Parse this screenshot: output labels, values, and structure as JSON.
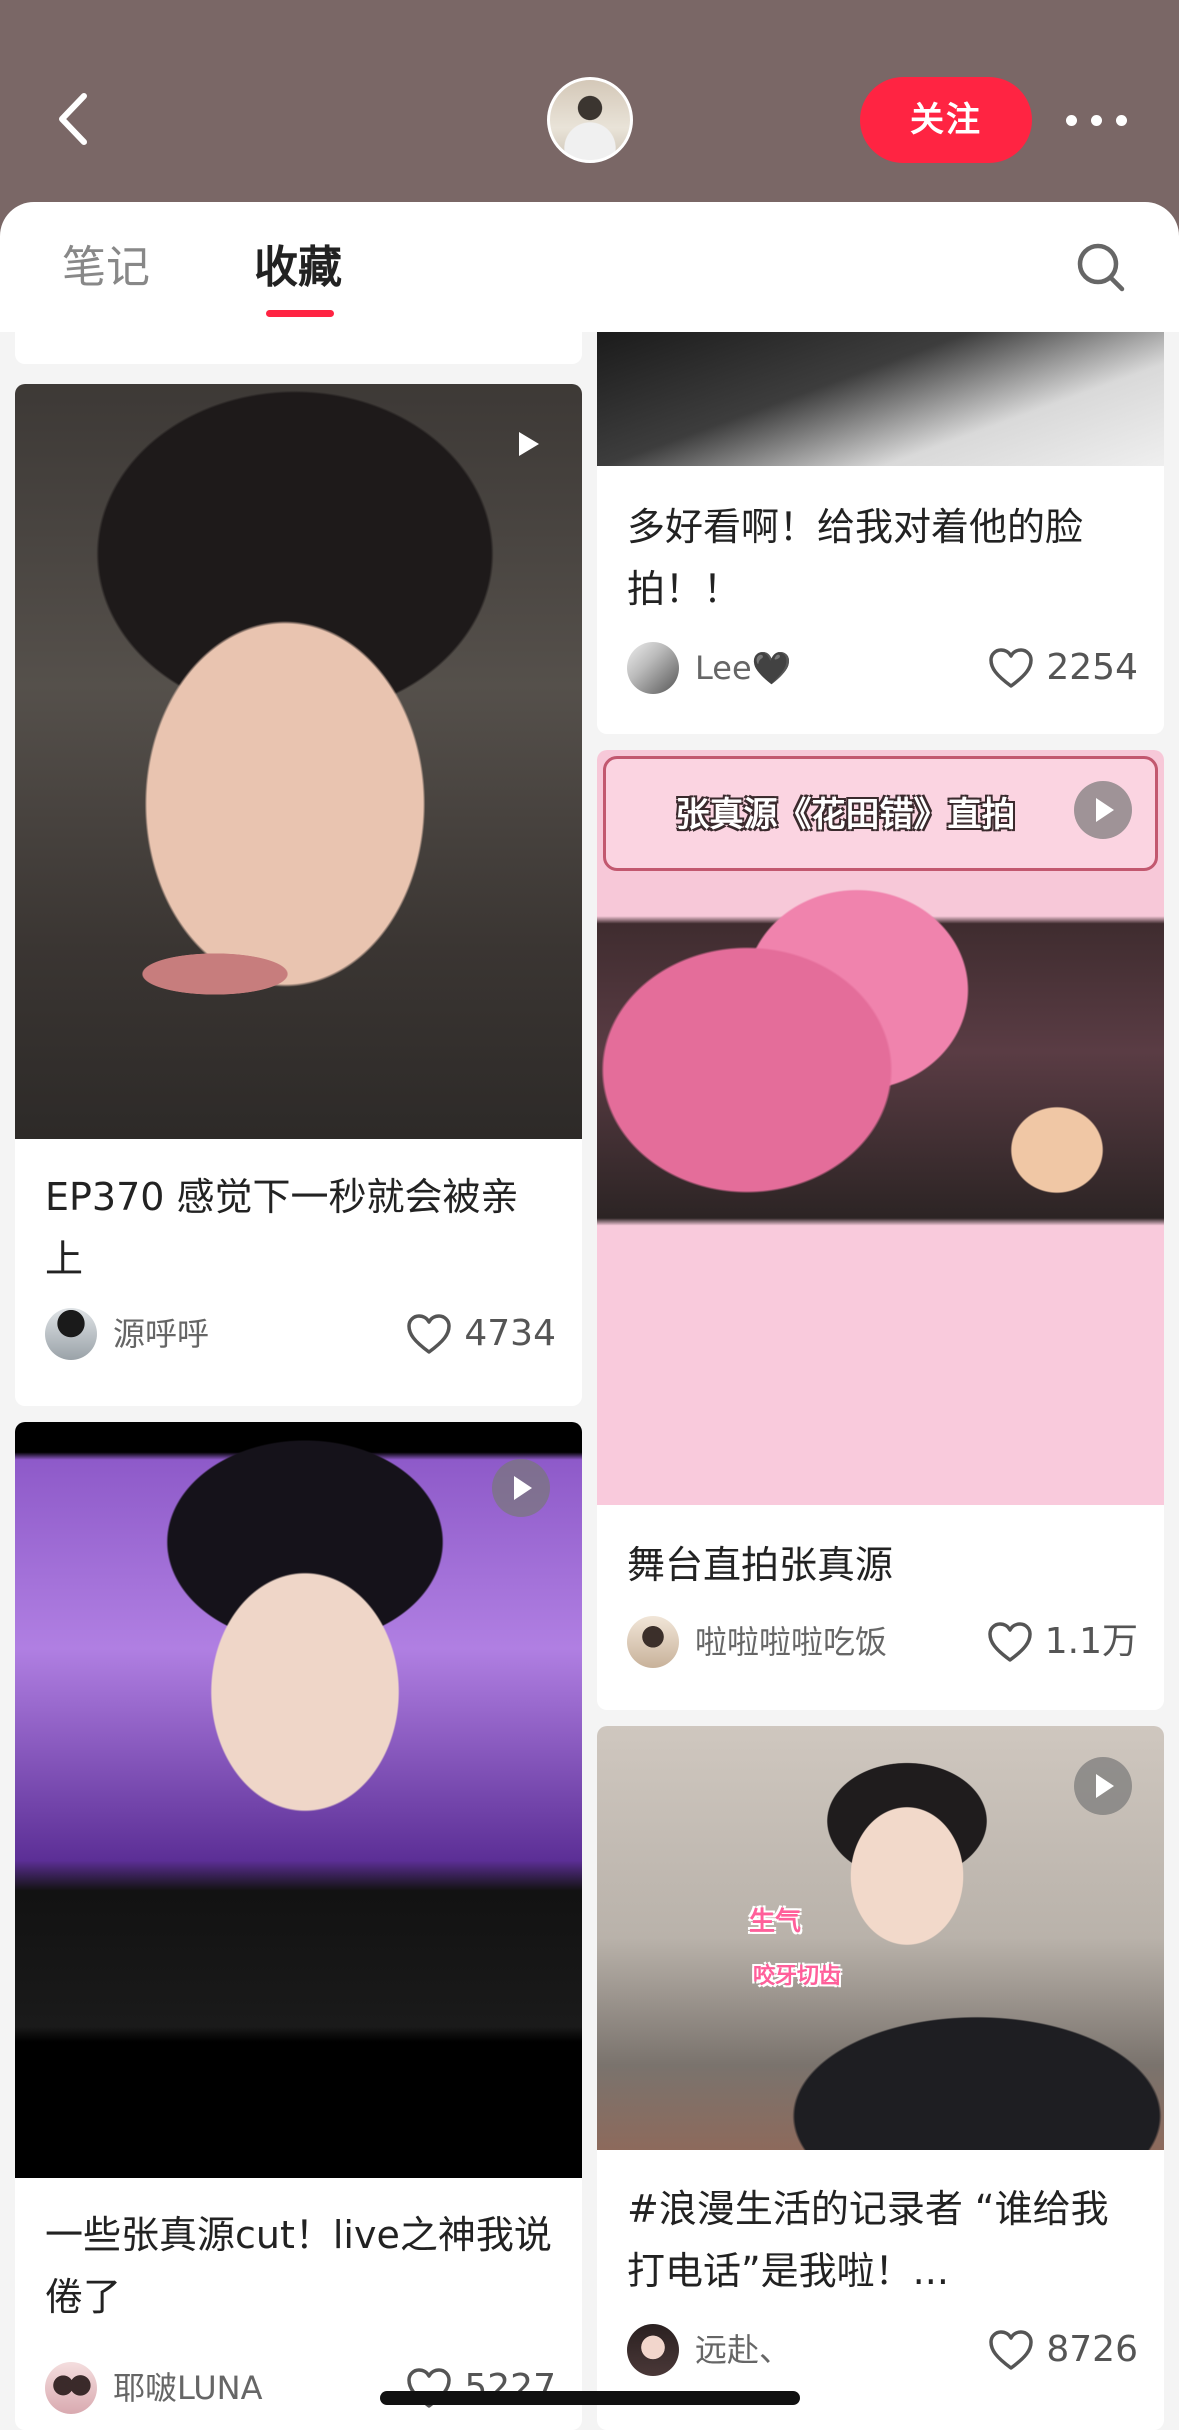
{
  "header": {
    "follow_label": "关注",
    "bg_color": "#7a6766",
    "accent": "#ff2442"
  },
  "tabs": [
    {
      "label": "笔记",
      "active": false
    },
    {
      "label": "收藏",
      "active": true
    }
  ],
  "icons": {
    "back": "chevron-left-icon",
    "more": "more-dots-icon",
    "search": "search-icon",
    "play": "play-icon",
    "like": "heart-outline-icon"
  },
  "feed": {
    "left": [
      {
        "title": "EP370 感觉下一秒就会被亲上",
        "author": "源呼呼",
        "likes": "4734",
        "video": true
      },
      {
        "title": "一些张真源cut！live之神我说倦了",
        "author": "耶啵LUNA",
        "likes": "5227",
        "video": true
      }
    ],
    "right": [
      {
        "title": "多好看啊！给我对着他的脸拍！！",
        "author": "Lee🖤",
        "likes": "2254",
        "video": false
      },
      {
        "title": "舞台直拍张真源",
        "author": "啦啦啦啦吃饭",
        "likes": "1.1万",
        "video": true,
        "image_caption": "张真源《花田错》直拍"
      },
      {
        "title": "#浪漫生活的记录者 “谁给我打电话”是我啦！...",
        "author": "远赴、",
        "likes": "8726",
        "video": true,
        "image_captions": [
          "生气",
          "咬牙切齿"
        ]
      }
    ]
  }
}
